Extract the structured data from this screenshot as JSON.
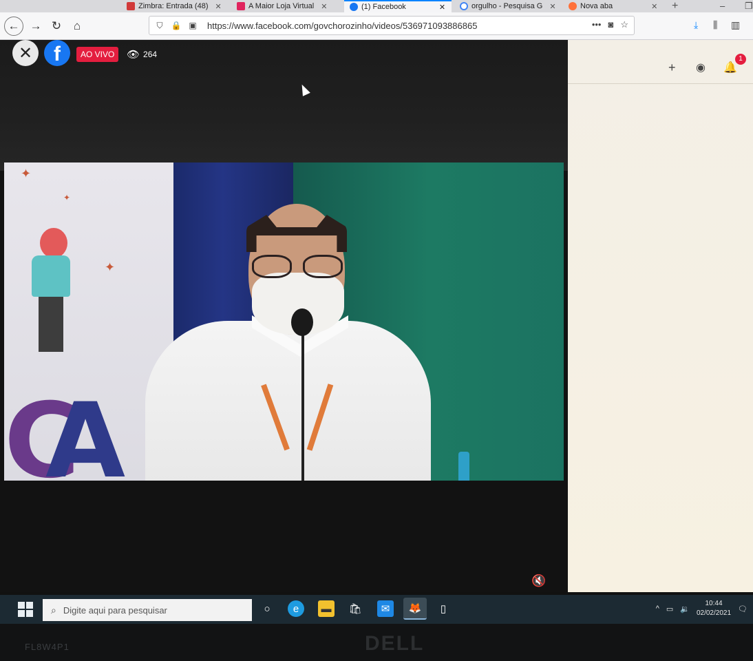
{
  "browser": {
    "tabs": [
      {
        "title": "Zimbra: Entrada (48)",
        "active": false,
        "color": "#d13a3a"
      },
      {
        "title": "A Maior Loja Virtual",
        "active": false,
        "color": "#e0245e"
      },
      {
        "title": "(1) Facebook",
        "active": true,
        "color": "#1877f2"
      },
      {
        "title": "orgulho - Pesquisa G",
        "active": false,
        "color": "#4285f4"
      },
      {
        "title": "Nova aba",
        "active": false,
        "color": "#ff7139"
      }
    ],
    "new_tab_symbol": "+",
    "url": "https://www.facebook.com/govchorozinho/videos/536971093886865",
    "page_actions": "•••",
    "nav": {
      "back": "←",
      "forward": "→",
      "reload": "↻",
      "home": "⌂"
    }
  },
  "viewer": {
    "close_symbol": "✕",
    "logo_letter": "f",
    "live_label": "AO VIVO",
    "viewer_count": "264",
    "mute_symbol": "🔇"
  },
  "facebook_header": {
    "create_symbol": "+",
    "notification_count": "1"
  },
  "taskbar": {
    "search_placeholder": "Digite aqui para pesquisar",
    "time": "10:44",
    "date": "02/02/2021",
    "icons": [
      "cortana-icon",
      "edge-icon",
      "file-explorer-icon",
      "store-icon",
      "mail-icon",
      "firefox-icon",
      "notepad-icon"
    ]
  },
  "monitor": {
    "serial": "FL8W4P1",
    "brand": "DELL"
  }
}
